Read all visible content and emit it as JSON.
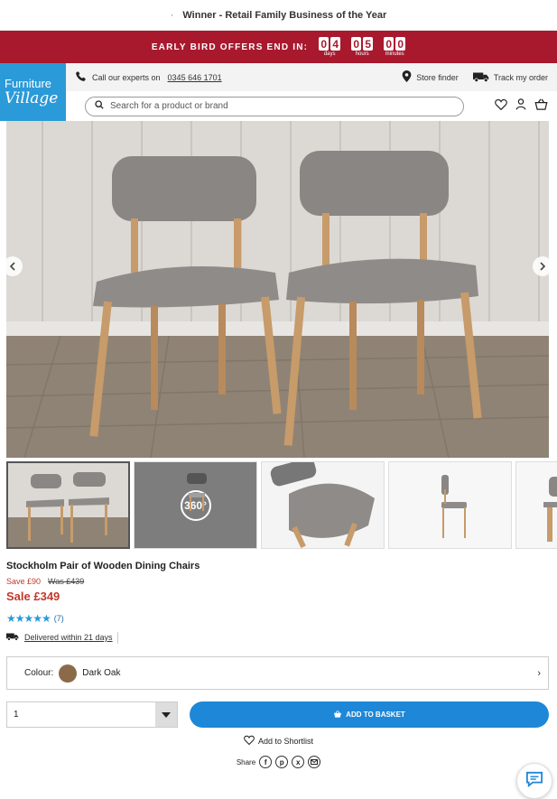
{
  "top_message": "Winner - Retail Family Business of the Year",
  "promo": {
    "label": "EARLY BIRD OFFERS END IN:",
    "countdown": [
      {
        "digits": [
          "0",
          "4"
        ],
        "unit": "days"
      },
      {
        "digits": [
          "0",
          "5"
        ],
        "unit": "hours"
      },
      {
        "digits": [
          "0",
          "0"
        ],
        "unit": "minutes"
      }
    ],
    "color": "#a8192e"
  },
  "logo": {
    "line1": "Furniture",
    "line2": "Village",
    "color": "#2b9ad8"
  },
  "utility": {
    "call_text": "Call our experts on",
    "phone": "0345 646 1701",
    "store_finder": "Store finder",
    "track_order": "Track my order"
  },
  "search": {
    "placeholder": "Search for a product or brand"
  },
  "header_icons": [
    "heart-icon",
    "user-icon",
    "basket-icon"
  ],
  "gallery": {
    "thumbnails": [
      {
        "type": "image",
        "label": "chairs-front"
      },
      {
        "type": "360",
        "label": "360°"
      },
      {
        "type": "image",
        "label": "seat-closeup"
      },
      {
        "type": "image",
        "label": "chair-side"
      },
      {
        "type": "image",
        "label": "chair-back"
      }
    ]
  },
  "product": {
    "title": "Stockholm Pair of Wooden Dining Chairs",
    "save": "Save £90",
    "was": "Was £439",
    "sale": "Sale £349",
    "rating_stars": "★★★★★",
    "rating_count": "(7)",
    "delivery": "Delivered within 21 days",
    "colour_label": "Colour:",
    "colour_value": "Dark Oak",
    "colour_swatch": "#8b6a4a",
    "quantity": "1",
    "add_to_basket": "ADD TO BASKET",
    "shortlist": "Add to Shortlist",
    "share_label": "Share"
  },
  "accent_color": "#1e87d8"
}
